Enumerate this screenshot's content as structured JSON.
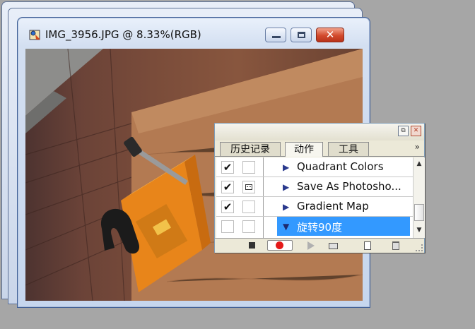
{
  "document_window": {
    "title": "IMG_3956.JPG @ 8.33%(RGB)",
    "minimize_icon": "minimize-icon",
    "maximize_icon": "maximize-icon",
    "close_icon": "close-icon",
    "close_glyph": "✕"
  },
  "actions_panel": {
    "tabs": [
      "历史记录",
      "动作",
      "工具"
    ],
    "active_tab": "动作",
    "more_glyph": "»",
    "restore_glyph": "⧉",
    "close_glyph": "✕",
    "actions": [
      {
        "checked": true,
        "dialog": false,
        "label": "Quadrant Colors",
        "selected": false
      },
      {
        "checked": true,
        "dialog": true,
        "label": "Save As Photosho...",
        "selected": false
      },
      {
        "checked": true,
        "dialog": false,
        "label": "Gradient Map",
        "selected": false
      },
      {
        "checked": false,
        "dialog": false,
        "label": "旋转90度",
        "selected": true,
        "expanded": true
      }
    ],
    "check_glyph": "✔",
    "collapsed_glyph": "▶",
    "expanded_glyph": "▼",
    "scroll_up_glyph": "▲",
    "scroll_down_glyph": "▼",
    "footer_icons": [
      "stop-icon",
      "record-icon",
      "play-icon",
      "folder-icon",
      "new-action-icon",
      "trash-icon"
    ]
  },
  "colors": {
    "selection": "#3399ff",
    "record_red": "#e41a1a",
    "title_bar": "#c6d6ee"
  }
}
